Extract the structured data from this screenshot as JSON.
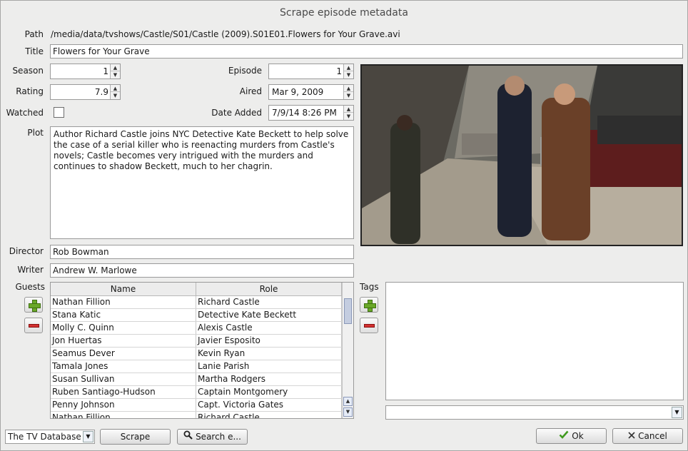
{
  "window": {
    "title": "Scrape episode metadata"
  },
  "labels": {
    "path": "Path",
    "title": "Title",
    "season": "Season",
    "episode": "Episode",
    "rating": "Rating",
    "aired": "Aired",
    "watched": "Watched",
    "date_added": "Date Added",
    "plot": "Plot",
    "director": "Director",
    "writer": "Writer",
    "guests": "Guests",
    "tags": "Tags"
  },
  "fields": {
    "path": "/media/data/tvshows/Castle/S01/Castle (2009).S01E01.Flowers for Your Grave.avi",
    "title": "Flowers for Your Grave",
    "season": "1",
    "episode": "1",
    "rating": "7.9",
    "aired": "Mar 9, 2009",
    "date_added": "7/9/14 8:26 PM",
    "watched": false,
    "plot": "Author Richard Castle joins NYC Detective Kate Beckett to help solve the case of a serial killer who is reenacting murders from Castle's novels; Castle becomes very intrigued with the murders and continues to shadow Beckett, much to her chagrin.",
    "director": "Rob Bowman",
    "writer": "Andrew W. Marlowe"
  },
  "guests": {
    "columns": [
      "Name",
      "Role"
    ],
    "rows": [
      [
        "Nathan Fillion",
        "Richard Castle"
      ],
      [
        "Stana Katic",
        "Detective Kate Beckett"
      ],
      [
        "Molly C. Quinn",
        "Alexis Castle"
      ],
      [
        "Jon Huertas",
        "Javier Esposito"
      ],
      [
        "Seamus Dever",
        "Kevin Ryan"
      ],
      [
        "Tamala Jones",
        "Lanie Parish"
      ],
      [
        "Susan Sullivan",
        "Martha Rodgers"
      ],
      [
        "Ruben Santiago-Hudson",
        "Captain Montgomery"
      ],
      [
        "Penny Johnson",
        "Capt. Victoria Gates"
      ],
      [
        "Nathan Fillion",
        "Richard Castle"
      ]
    ]
  },
  "footer": {
    "scraper": "The TV Database",
    "scrape": "Scrape",
    "search": "Search e...",
    "ok": "Ok",
    "cancel": "Cancel"
  },
  "colors": {
    "add": "#6aa828",
    "remove": "#d23232",
    "ok_check": "#3f9a1e"
  }
}
